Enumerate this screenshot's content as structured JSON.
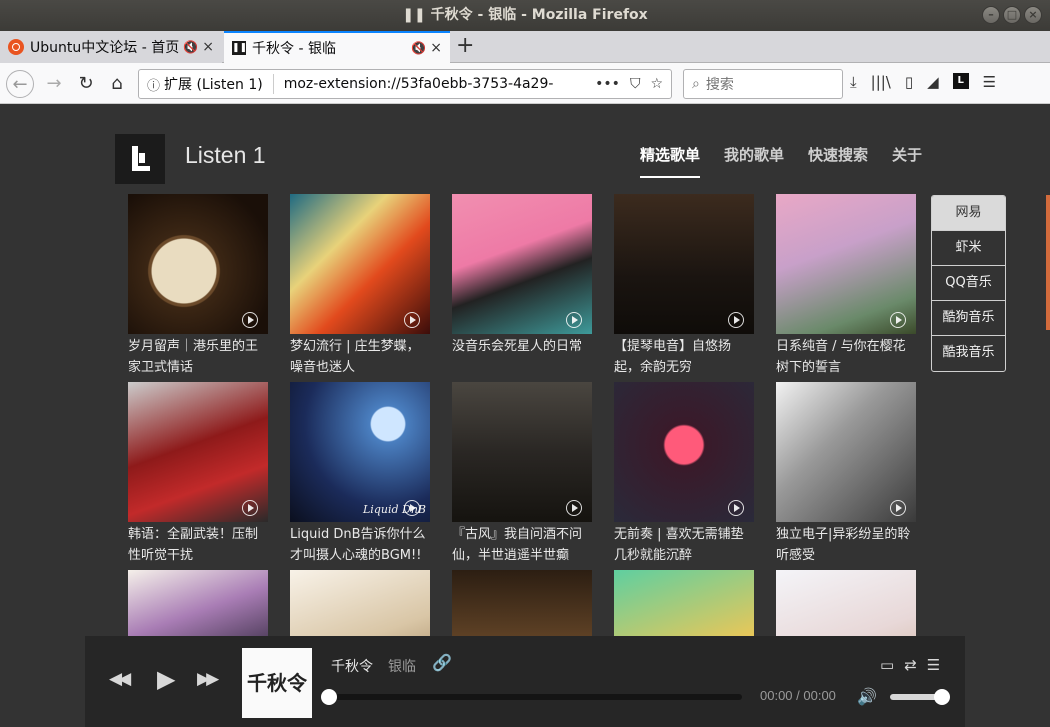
{
  "window": {
    "title": "❚❚ 千秋令 - 银临 - Mozilla Firefox",
    "buttons": [
      "–",
      "□",
      "×"
    ]
  },
  "tabs": [
    {
      "label": "Ubuntu中文论坛 - 首页",
      "mute": "🔇",
      "close": "×"
    },
    {
      "label": "千秋令 - 银临",
      "mute": "🔇",
      "close": "×",
      "favicon": "❚❚"
    }
  ],
  "newtab": "+",
  "navbar": {
    "back": "←",
    "forward": "→",
    "reload": "↻",
    "home": "⌂",
    "info": "ⓘ",
    "extension_label": "扩展 (Listen 1)",
    "url": "moz-extension://53fa0ebb-3753-4a29-",
    "url_actions": [
      "•••",
      "⛉",
      "☆"
    ],
    "search_placeholder": "搜索",
    "tool_icons": [
      "⤓",
      "|||\\",
      "▯",
      "◢",
      "L",
      "☰"
    ]
  },
  "app": {
    "name": "Listen 1",
    "nav": [
      {
        "label": "精选歌单",
        "active": true
      },
      {
        "label": "我的歌单",
        "active": false
      },
      {
        "label": "快速搜索",
        "active": false
      },
      {
        "label": "关于",
        "active": false
      }
    ],
    "platforms": [
      {
        "label": "网易",
        "active": true
      },
      {
        "label": "虾米",
        "active": false
      },
      {
        "label": "QQ音乐",
        "active": false
      },
      {
        "label": "酷狗音乐",
        "active": false
      },
      {
        "label": "酷我音乐",
        "active": false
      }
    ],
    "playlists": [
      {
        "title": "岁月留声｜港乐里的王家卫式情话"
      },
      {
        "title": "梦幻流行 | 庄生梦蝶，噪音也迷人"
      },
      {
        "title": "没音乐会死星人的日常"
      },
      {
        "title": "【提琴电音】自悠扬起，余韵无穷"
      },
      {
        "title": "日系纯音 / 与你在樱花树下的誓言"
      },
      {
        "title": "韩语：全副武装！压制性听觉干扰"
      },
      {
        "title": "Liquid DnB告诉你什么才叫摄人心魂的BGM!!",
        "overlay": "Liquid DnB"
      },
      {
        "title": "『古风』我自问酒不问仙，半世逍遥半世癫"
      },
      {
        "title": "无前奏 | 喜欢无需铺垫几秒就能沉醉"
      },
      {
        "title": "独立电子|异彩纷呈的聆听感受"
      },
      {
        "title": ""
      },
      {
        "title": ""
      },
      {
        "title": ""
      },
      {
        "title": ""
      },
      {
        "title": ""
      }
    ]
  },
  "player": {
    "prev": "◀◀",
    "play": "▶",
    "next": "▶▶",
    "cover_text": "千秋令",
    "song": "千秋令",
    "artist": "银临",
    "link_icon": "🔗",
    "time": "00:00 / 00:00",
    "volume_icon": "🔊",
    "progress": 0,
    "volume": 1,
    "right_icons": [
      "▭",
      "⇄",
      "☰"
    ]
  }
}
